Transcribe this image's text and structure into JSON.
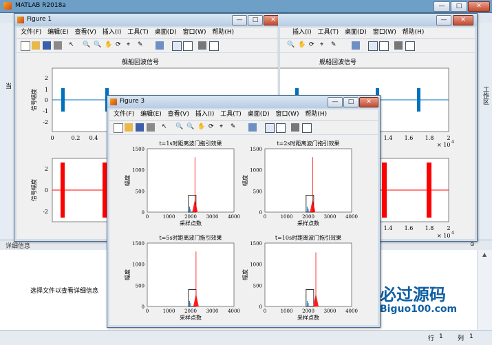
{
  "app": {
    "title": "MATLAB R2018a",
    "window_controls": [
      "—",
      "□",
      "✕"
    ]
  },
  "figure1": {
    "title": "Figure 1",
    "menu": [
      "文件(F)",
      "编辑(E)",
      "查看(V)",
      "插入(I)",
      "工具(T)",
      "桌面(D)",
      "窗口(W)",
      "帮助(H)"
    ],
    "plot_title": "舰船回波信号",
    "top_ylabel": "信号幅度",
    "bottom_ylabel": "信号幅度",
    "top_yticks": [
      "2",
      "1",
      "0",
      "-1",
      "-2"
    ],
    "bottom_yticks": [
      "2",
      "0",
      "-2"
    ],
    "xticks_visible": [
      "0",
      "0.2",
      "0.4"
    ],
    "right_xticks": [
      "1.4",
      "1.6",
      "1.8",
      "2"
    ],
    "exponent": "× 10",
    "exponent_power": "4",
    "colors": {
      "top_series": "#0072bd",
      "bottom_series": "#ff0000"
    }
  },
  "figure3": {
    "title": "Figure 3",
    "menu": [
      "文件(F)",
      "编辑(E)",
      "查看(V)",
      "插入(I)",
      "工具(T)",
      "桌面(D)",
      "窗口(W)",
      "帮助(H)"
    ],
    "subplots": [
      {
        "title": "t=1s时距离波门拖引效果",
        "xlabel": "采样点数",
        "ylabel": "幅度",
        "yticks": [
          "1500",
          "1000",
          "500",
          "0"
        ],
        "xticks": [
          "0",
          "1000",
          "2000",
          "3000",
          "4000"
        ]
      },
      {
        "title": "t=2s时距离波门拖引效果",
        "xlabel": "采样点数",
        "ylabel": "幅度",
        "yticks": [
          "1500",
          "1000",
          "500",
          "0"
        ],
        "xticks": [
          "0",
          "1000",
          "2000",
          "3000",
          "4000"
        ]
      },
      {
        "title": "t=5s时距离波门拖引效果",
        "xlabel": "采样点数",
        "ylabel": "幅度",
        "yticks": [
          "1500",
          "1000",
          "500",
          "0"
        ],
        "xticks": [
          "0",
          "1000",
          "2000",
          "3000",
          "4000"
        ]
      },
      {
        "title": "t=10s时距离波门拖引效果",
        "xlabel": "采样点数",
        "ylabel": "幅度",
        "yticks": [
          "1500",
          "1000",
          "500",
          "0"
        ],
        "xticks": [
          "0",
          "1000",
          "2000",
          "3000",
          "4000"
        ]
      }
    ]
  },
  "sidebar": {
    "left_label": "当",
    "right_label": "工作区"
  },
  "details": {
    "header": "详细信息",
    "message": "选择文件以查看详细信息"
  },
  "watermark": {
    "name": "必过源码",
    "url": "Biguo100.com"
  },
  "status": {
    "row_label": "行",
    "row_value": "1",
    "col_label": "列",
    "col_value": "1"
  }
}
